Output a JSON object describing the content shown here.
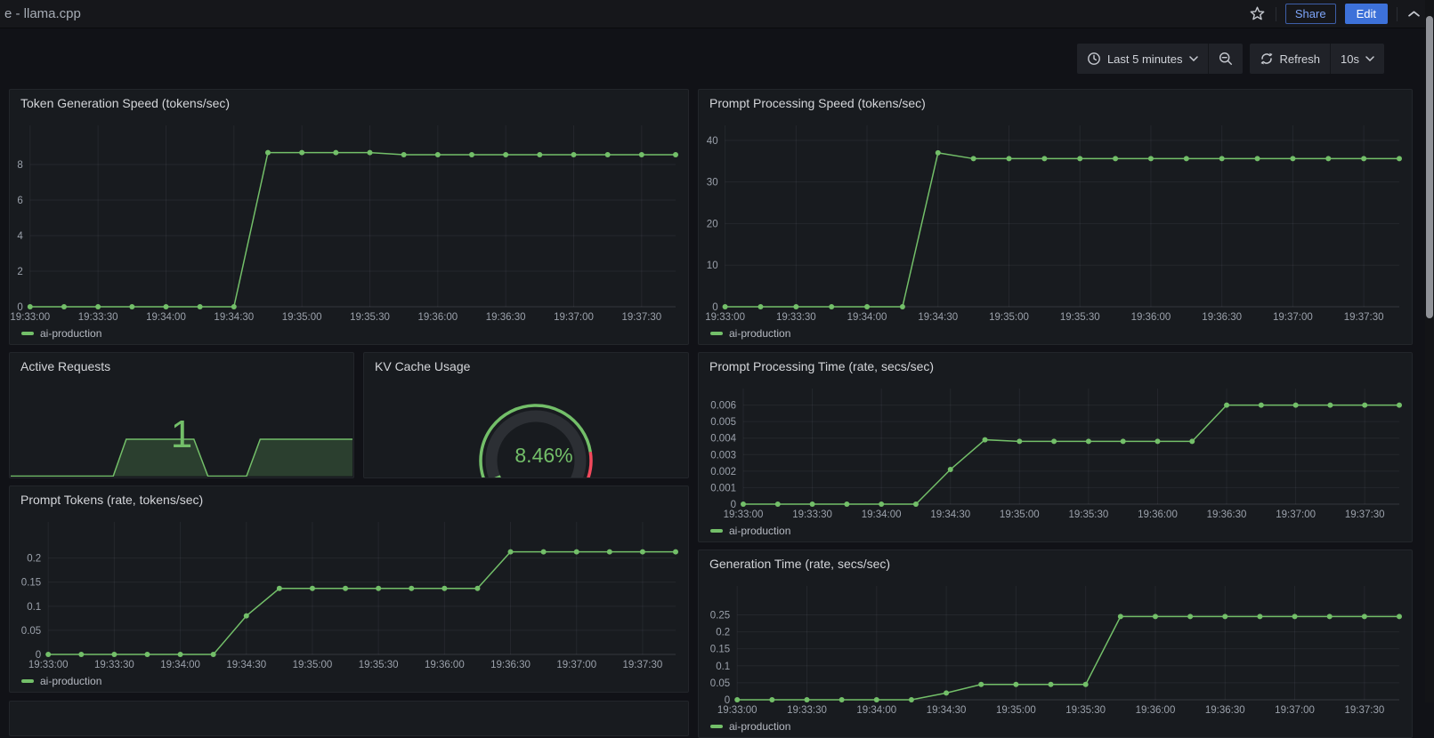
{
  "header": {
    "title": "e - llama.cpp",
    "share_label": "Share",
    "edit_label": "Edit"
  },
  "toolbar": {
    "time_range": "Last 5 minutes",
    "refresh_label": "Refresh",
    "refresh_interval": "10s"
  },
  "colors": {
    "series_green": "#73BF69",
    "threshold_red": "#F2495C",
    "accent_blue": "#3D71D9",
    "panel_bg": "#181b1f",
    "page_bg": "#111217"
  },
  "chart_data": [
    {
      "id": "token-generation-speed",
      "type": "line",
      "title": "Token Generation Speed (tokens/sec)",
      "legend": "ai-production",
      "legend_position": "bottom",
      "grid": true,
      "color": "#73BF69",
      "x": [
        "19:33:00",
        "19:33:15",
        "19:33:30",
        "19:33:45",
        "19:34:00",
        "19:34:15",
        "19:34:30",
        "19:34:45",
        "19:35:00",
        "19:35:15",
        "19:35:30",
        "19:35:45",
        "19:36:00",
        "19:36:15",
        "19:36:30",
        "19:36:45",
        "19:37:00",
        "19:37:15",
        "19:37:30",
        "19:37:45"
      ],
      "values": [
        0,
        0,
        0,
        0,
        0,
        0,
        0,
        8.67,
        8.67,
        8.67,
        8.67,
        8.55,
        8.55,
        8.55,
        8.55,
        8.55,
        8.55,
        8.55,
        8.55,
        8.55
      ],
      "yticks": [
        [
          0,
          "0"
        ],
        [
          2,
          "2"
        ],
        [
          4,
          "4"
        ],
        [
          6,
          "6"
        ],
        [
          8,
          "8"
        ]
      ],
      "ylim": [
        0,
        10.2
      ],
      "xtick_every": 2
    },
    {
      "id": "prompt-processing-speed",
      "type": "line",
      "title": "Prompt Processing Speed (tokens/sec)",
      "legend": "ai-production",
      "legend_position": "bottom",
      "grid": true,
      "color": "#73BF69",
      "x": [
        "19:33:00",
        "19:33:15",
        "19:33:30",
        "19:33:45",
        "19:34:00",
        "19:34:15",
        "19:34:30",
        "19:34:45",
        "19:35:00",
        "19:35:15",
        "19:35:30",
        "19:35:45",
        "19:36:00",
        "19:36:15",
        "19:36:30",
        "19:36:45",
        "19:37:00",
        "19:37:15",
        "19:37:30",
        "19:37:45"
      ],
      "values": [
        0,
        0,
        0,
        0,
        0,
        0,
        37,
        35.6,
        35.6,
        35.6,
        35.6,
        35.6,
        35.6,
        35.6,
        35.6,
        35.6,
        35.6,
        35.6,
        35.6,
        35.6
      ],
      "yticks": [
        [
          0,
          "0"
        ],
        [
          10,
          "10"
        ],
        [
          20,
          "20"
        ],
        [
          30,
          "30"
        ],
        [
          40,
          "40"
        ]
      ],
      "ylim": [
        0,
        43.6
      ],
      "xtick_every": 2
    },
    {
      "id": "active-requests",
      "type": "stat",
      "title": "Active Requests",
      "value": "1",
      "color": "#73BF69",
      "sparkline": {
        "points": [
          [
            0,
            0
          ],
          [
            0.3,
            0
          ],
          [
            0.338,
            1
          ],
          [
            0.536,
            1
          ],
          [
            0.577,
            0
          ],
          [
            0.69,
            0
          ],
          [
            0.73,
            1
          ],
          [
            1,
            1
          ]
        ],
        "ymax": 1
      }
    },
    {
      "id": "kv-cache-usage",
      "type": "gauge",
      "title": "KV Cache Usage",
      "value": 8.46,
      "display": "8.46%",
      "min": 0,
      "max": 100,
      "thresholds": [
        {
          "color": "#73BF69",
          "from": 0
        },
        {
          "color": "#F2495C",
          "from": 80
        }
      ]
    },
    {
      "id": "prompt-processing-time",
      "type": "line",
      "title": "Prompt Processing Time (rate, secs/sec)",
      "legend": "ai-production",
      "legend_position": "bottom",
      "grid": true,
      "color": "#73BF69",
      "x": [
        "19:33:00",
        "19:33:15",
        "19:33:30",
        "19:33:45",
        "19:34:00",
        "19:34:15",
        "19:34:30",
        "19:34:45",
        "19:35:00",
        "19:35:15",
        "19:35:30",
        "19:35:45",
        "19:36:00",
        "19:36:15",
        "19:36:30",
        "19:36:45",
        "19:37:00",
        "19:37:15",
        "19:37:30",
        "19:37:45"
      ],
      "values": [
        0,
        0,
        0,
        0,
        0,
        0,
        0.0021,
        0.0039,
        0.0038,
        0.0038,
        0.0038,
        0.0038,
        0.0038,
        0.0038,
        0.006,
        0.006,
        0.006,
        0.006,
        0.006,
        0.006
      ],
      "yticks": [
        [
          0,
          "0"
        ],
        [
          0.001,
          "0.001"
        ],
        [
          0.002,
          "0.002"
        ],
        [
          0.003,
          "0.003"
        ],
        [
          0.004,
          "0.004"
        ],
        [
          0.005,
          "0.005"
        ],
        [
          0.006,
          "0.006"
        ]
      ],
      "ylim": [
        0,
        0.007
      ],
      "xtick_every": 2
    },
    {
      "id": "prompt-tokens",
      "type": "line",
      "title": "Prompt Tokens (rate, tokens/sec)",
      "legend": "ai-production",
      "legend_position": "bottom",
      "grid": true,
      "color": "#73BF69",
      "x": [
        "19:33:00",
        "19:33:15",
        "19:33:30",
        "19:33:45",
        "19:34:00",
        "19:34:15",
        "19:34:30",
        "19:34:45",
        "19:35:00",
        "19:35:15",
        "19:35:30",
        "19:35:45",
        "19:36:00",
        "19:36:15",
        "19:36:30",
        "19:36:45",
        "19:37:00",
        "19:37:15",
        "19:37:30",
        "19:37:45"
      ],
      "values": [
        0,
        0,
        0,
        0,
        0,
        0,
        0.08,
        0.137,
        0.137,
        0.137,
        0.137,
        0.137,
        0.137,
        0.137,
        0.213,
        0.213,
        0.213,
        0.213,
        0.213,
        0.213
      ],
      "yticks": [
        [
          0,
          "0"
        ],
        [
          0.05,
          "0.05"
        ],
        [
          0.1,
          "0.1"
        ],
        [
          0.15,
          "0.15"
        ],
        [
          0.2,
          "0.2"
        ]
      ],
      "ylim": [
        0,
        0.275
      ],
      "xtick_every": 2
    },
    {
      "id": "generation-time",
      "type": "line",
      "title": "Generation Time (rate, secs/sec)",
      "legend": "ai-production",
      "legend_position": "bottom",
      "grid": true,
      "color": "#73BF69",
      "x": [
        "19:33:00",
        "19:33:15",
        "19:33:30",
        "19:33:45",
        "19:34:00",
        "19:34:15",
        "19:34:30",
        "19:34:45",
        "19:35:00",
        "19:35:15",
        "19:35:30",
        "19:35:45",
        "19:36:00",
        "19:36:15",
        "19:36:30",
        "19:36:45",
        "19:37:00",
        "19:37:15",
        "19:37:30",
        "19:37:45"
      ],
      "values": [
        0,
        0,
        0,
        0,
        0,
        0,
        0.02,
        0.045,
        0.045,
        0.045,
        0.045,
        0.245,
        0.245,
        0.245,
        0.245,
        0.245,
        0.245,
        0.245,
        0.245,
        0.245
      ],
      "yticks": [
        [
          0,
          "0"
        ],
        [
          0.05,
          "0.05"
        ],
        [
          0.1,
          "0.1"
        ],
        [
          0.15,
          "0.15"
        ],
        [
          0.2,
          "0.2"
        ],
        [
          0.25,
          "0.25"
        ]
      ],
      "ylim": [
        0,
        0.335
      ],
      "xtick_every": 2
    }
  ]
}
